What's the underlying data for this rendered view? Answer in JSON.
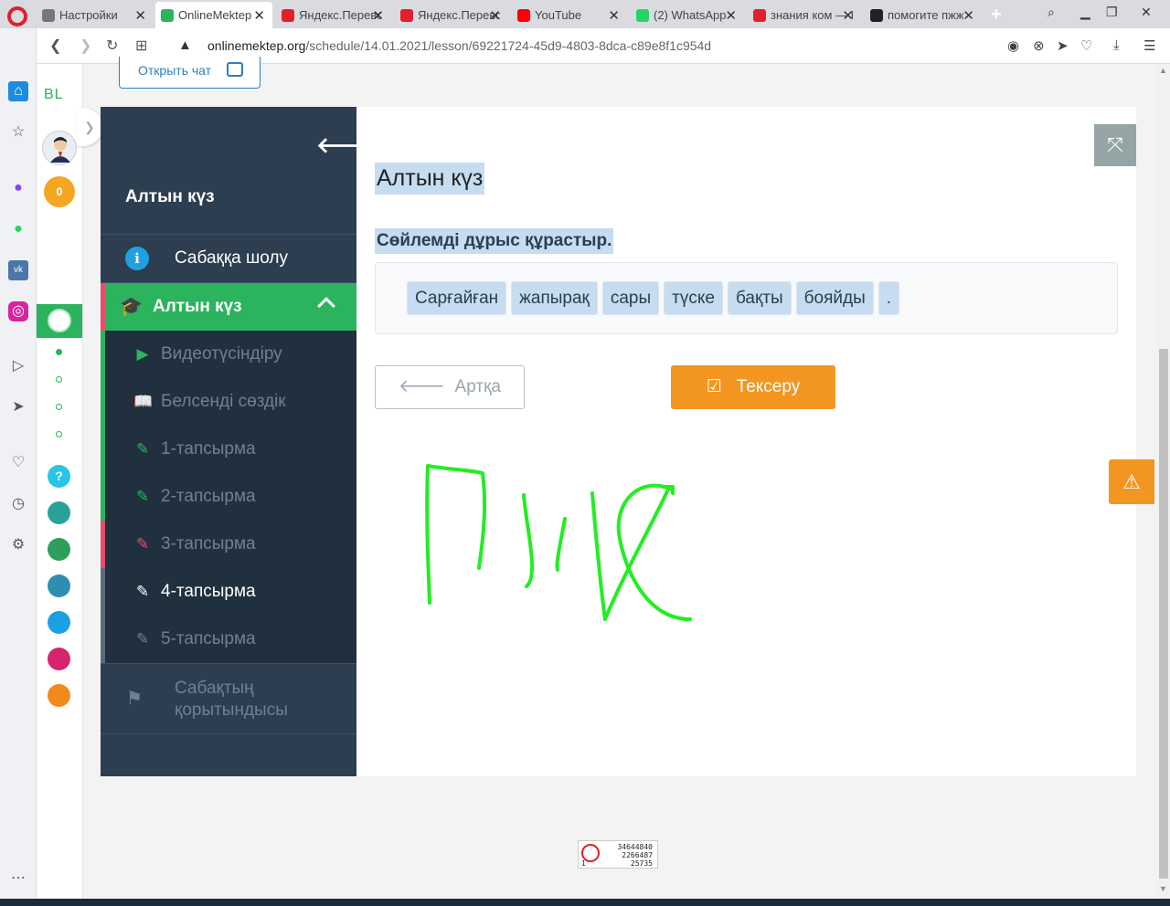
{
  "browser": {
    "tabs": [
      {
        "title": "Настройки",
        "fav_color": "#777777",
        "fav_type": "gear-icon"
      },
      {
        "title": "OnlineMektep",
        "fav_color": "#2bb35e",
        "fav_type": "onlinemektep-icon"
      },
      {
        "title": "Яндекс.Переводчик",
        "fav_color": "#e0202c",
        "fav_type": "yandex-translate-icon"
      },
      {
        "title": "Яндекс.Переводчик",
        "fav_color": "#e0202c",
        "fav_type": "yandex-translate-icon"
      },
      {
        "title": "YouTube",
        "fav_color": "#ff0000",
        "fav_type": "youtube-icon"
      },
      {
        "title": "(2) WhatsApp",
        "fav_color": "#25d366",
        "fav_type": "whatsapp-icon"
      },
      {
        "title": "знания ком — Поиск",
        "fav_color": "#e0202c",
        "fav_type": "yandex-icon"
      },
      {
        "title": "помогите пжж",
        "fav_color": "#222222",
        "fav_type": "znanija-icon"
      }
    ],
    "url_domain": "onlinemektep.org",
    "url_path": "/schedule/14.01.2021/lesson/69221724-45d9-4803-8dca-c89e8f1c954d"
  },
  "site": {
    "logo": "BL",
    "coins": "0",
    "chat_button": "Открыть чат"
  },
  "course_menu": {
    "title": "Алтын күз",
    "overview": "Сабаққа шолу",
    "active_section": "Алтын күз",
    "items": [
      {
        "label": "Видеотүсіндіру",
        "icon": "▶",
        "icon_color": "#2bb35e",
        "bar_color": "#2bb35e",
        "current": false
      },
      {
        "label": "Белсенді сөздік",
        "icon": "📖",
        "icon_color": "#2bb35e",
        "bar_color": "#2bb35e",
        "current": false
      },
      {
        "label": "1-тапсырма",
        "icon": "✎",
        "icon_color": "#2bb35e",
        "bar_color": "#2bb35e",
        "current": false
      },
      {
        "label": "2-тапсырма",
        "icon": "✎",
        "icon_color": "#2bb35e",
        "bar_color": "#2bb35e",
        "current": false
      },
      {
        "label": "3-тапсырма",
        "icon": "✎",
        "icon_color": "#e74c6c",
        "bar_color": "#e74c6c",
        "current": false
      },
      {
        "label": "4-тапсырма",
        "icon": "✎",
        "icon_color": "#ffffff",
        "bar_color": "#5a6b7d",
        "current": true
      },
      {
        "label": "5-тапсырма",
        "icon": "✎",
        "icon_color": "#6f8093",
        "bar_color": "#5a6b7d",
        "current": false
      }
    ],
    "summary": "Сабақтың қорытындысы"
  },
  "content": {
    "title": "Алтын күз",
    "instruction": "Сөйлемді дұрыс құрастыр.",
    "words": [
      "Сарғайған",
      "жапырақ",
      "сары",
      "түске",
      "бақты",
      "бояйды",
      "."
    ],
    "back_button": "Артқа",
    "check_button": "Тексеру"
  },
  "counter": {
    "line1": "34644840",
    "line2": "2266487",
    "line3": "25735",
    "corner": "1"
  }
}
